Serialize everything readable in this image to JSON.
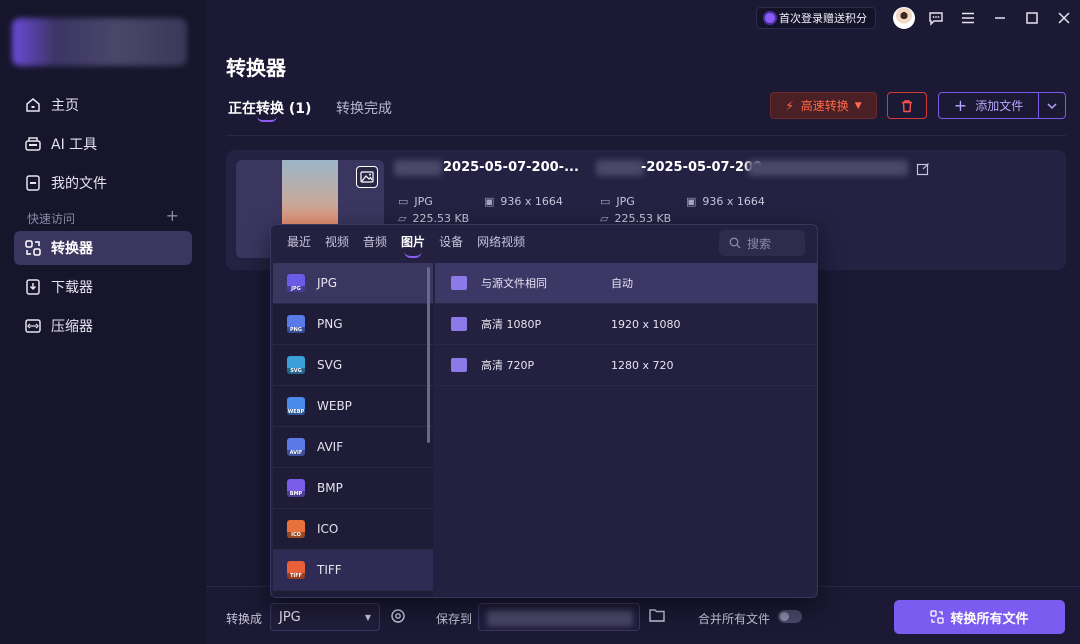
{
  "sidebar": {
    "items": [
      {
        "label": "主页",
        "icon": "home-icon"
      },
      {
        "label": "AI 工具",
        "icon": "ai-tools-icon"
      },
      {
        "label": "我的文件",
        "icon": "file-icon"
      },
      {
        "label": "转换器",
        "icon": "converter-icon",
        "active": true
      },
      {
        "label": "下载器",
        "icon": "download-icon"
      },
      {
        "label": "压缩器",
        "icon": "compress-icon"
      }
    ],
    "quick_access": "快速访问",
    "quick_add": "+"
  },
  "topbar": {
    "promo": "首次登录赠送积分"
  },
  "page": {
    "title": "转换器",
    "tab_converting": "正在转换 (1)",
    "tab_done": "转换完成",
    "btn_fast": "高速转换",
    "btn_add": "添加文件"
  },
  "file": {
    "source_name": "2025-05-07-200-...",
    "source_format": "JPG",
    "source_resolution": "936 x 1664",
    "source_size": "225.53 KB",
    "target_name": "-2025-05-07-200",
    "target_format": "JPG",
    "target_resolution": "936 x 1664",
    "target_size": "225.53 KB"
  },
  "popup": {
    "tabs": [
      "最近",
      "视频",
      "音频",
      "图片",
      "设备",
      "网络视频"
    ],
    "active_tab": "图片",
    "search_placeholder": "搜索",
    "formats": [
      {
        "name": "JPG",
        "tag": "JPG",
        "color": "#6b5ce8"
      },
      {
        "name": "PNG",
        "tag": "PNG",
        "color": "#5a7ae8"
      },
      {
        "name": "SVG",
        "tag": "SVG",
        "color": "#3aa0d8"
      },
      {
        "name": "WEBP",
        "tag": "WEBP",
        "color": "#4a8ae8"
      },
      {
        "name": "AVIF",
        "tag": "AVIF",
        "color": "#5a7ae8"
      },
      {
        "name": "BMP",
        "tag": "BMP",
        "color": "#7a5ce8"
      },
      {
        "name": "ICO",
        "tag": "ICO",
        "color": "#e8703a"
      },
      {
        "name": "TIFF",
        "tag": "TIFF",
        "color": "#e8603a"
      }
    ],
    "resolutions": [
      {
        "name": "与源文件相同",
        "value": "自动"
      },
      {
        "name": "高清 1080P",
        "value": "1920 x 1080"
      },
      {
        "name": "高清 720P",
        "value": "1280 x 720"
      }
    ]
  },
  "bottom": {
    "convert_to_label": "转换成",
    "convert_to_value": "JPG",
    "save_to_label": "保存到",
    "merge_label": "合并所有文件",
    "convert_all": "转换所有文件"
  },
  "colors": {
    "accent": "#7c5cf0",
    "danger": "#d43a3a",
    "fast": "#ff6b4a"
  }
}
